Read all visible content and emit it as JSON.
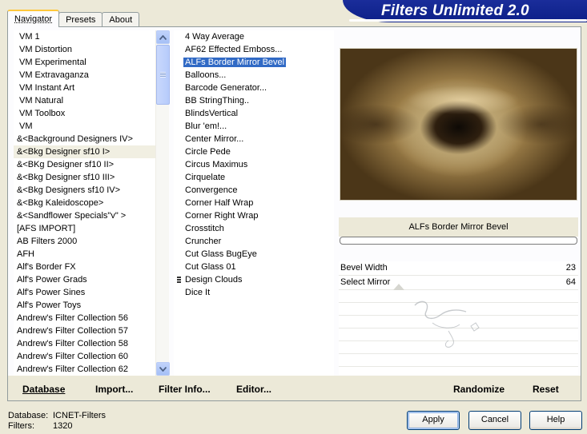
{
  "banner": {
    "title": "Filters Unlimited 2.0"
  },
  "tabs": [
    {
      "label": "Navigator",
      "active": true
    },
    {
      "label": "Presets",
      "active": false
    },
    {
      "label": "About",
      "active": false
    }
  ],
  "categories": {
    "items": [
      "VM 1",
      "VM Distortion",
      "VM Experimental",
      "VM Extravaganza",
      "VM Instant Art",
      "VM Natural",
      "VM Toolbox",
      "VM",
      "&<Background Designers IV>",
      "&<Bkg Designer sf10 I>",
      "&<BKg Designer sf10 II>",
      "&<Bkg Designer sf10 III>",
      "&<Bkg Designers sf10 IV>",
      "&<Bkg Kaleidoscope>",
      "&<Sandflower Specials\"v\" >",
      "[AFS IMPORT]",
      "AB Filters 2000",
      "AFH",
      "Alf's Border FX",
      "Alf's Power Grads",
      "Alf's Power Sines",
      "Alf's Power Toys",
      "Andrew's Filter Collection 56",
      "Andrew's Filter Collection 57",
      "Andrew's Filter Collection 58",
      "Andrew's Filter Collection 60",
      "Andrew's Filter Collection 62"
    ],
    "selected_index": 9
  },
  "filters": {
    "items": [
      "4 Way Average",
      "AF62 Effected Emboss...",
      "ALFs Border Mirror Bevel",
      "Balloons...",
      "Barcode Generator...",
      "BB StringThing..",
      "BlindsVertical",
      "Blur 'em!...",
      "Center Mirror...",
      "Circle Pede",
      "Circus Maximus",
      "Cirquelate",
      "Convergence",
      "Corner Half Wrap",
      "Corner Right Wrap",
      "Crosstitch",
      "Cruncher",
      "Cut Glass  BugEye",
      "Cut Glass 01",
      "Design Clouds",
      "Dice It"
    ],
    "selected_index": 2,
    "marked_index": 19
  },
  "preview": {
    "filter_name": "ALFs Border Mirror Bevel"
  },
  "params": [
    {
      "label": "Bevel Width",
      "value": "23"
    },
    {
      "label": "Select Mirror",
      "value": "64"
    }
  ],
  "toolbar": {
    "database": "Database",
    "import": "Import...",
    "filter_info": "Filter Info...",
    "editor": "Editor...",
    "randomize": "Randomize",
    "reset": "Reset"
  },
  "status": {
    "database_label": "Database:",
    "database_value": "ICNET-Filters",
    "filters_label": "Filters:",
    "filters_value": "1320"
  },
  "buttons": {
    "apply": "Apply",
    "cancel": "Cancel",
    "help": "Help"
  },
  "colors": {
    "banner": "#0c1f88",
    "selection": "#316ac5",
    "tab_accent": "#ffc83c"
  }
}
